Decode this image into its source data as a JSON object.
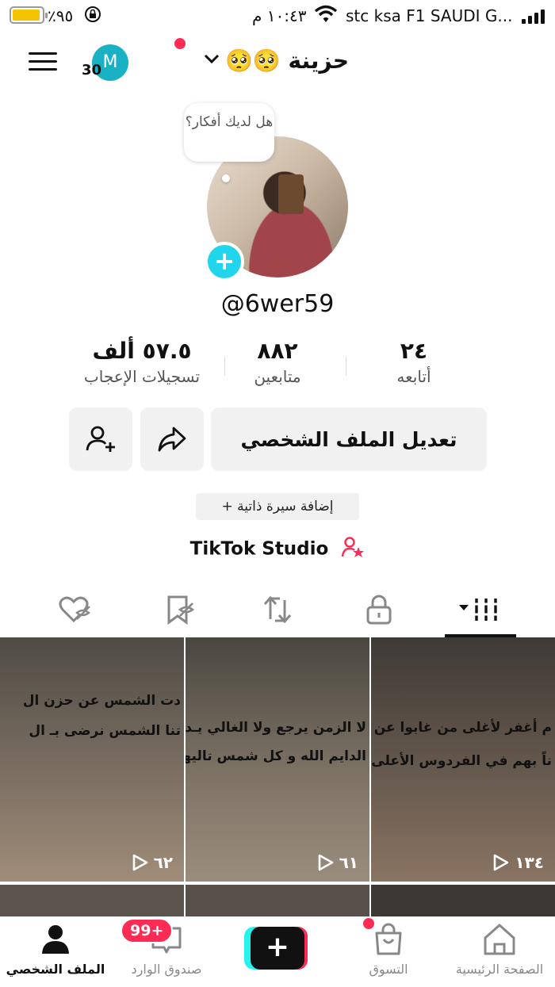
{
  "status_bar": {
    "battery_percent": "٪٩٥",
    "time": "١٠:٤٣ م",
    "carrier": "stc ksa F1 SAUDI G..."
  },
  "header": {
    "account_name": "حزينة 🥺🥺",
    "avatar_letter": "M",
    "badge_count": "30"
  },
  "profile": {
    "thought_bubble": "هل لديك أفكار؟",
    "username": "@6wer59"
  },
  "stats": {
    "following": {
      "value": "٢٤",
      "label": "أتابعه"
    },
    "followers": {
      "value": "٨٨٢",
      "label": "متابعين"
    },
    "likes": {
      "value": "٥٧.٥ ألف",
      "label": "تسجيلات الإعجاب"
    }
  },
  "actions": {
    "edit_profile": "تعديل الملف الشخصي",
    "add_bio": "+ إضافة سيرة ذاتية",
    "studio": "TikTok Studio"
  },
  "tabs": [
    {
      "icon": "grid-icon",
      "active": true
    },
    {
      "icon": "lock-icon",
      "active": false
    },
    {
      "icon": "repost-icon",
      "active": false
    },
    {
      "icon": "bookmark-icon",
      "active": false
    },
    {
      "icon": "liked-icon",
      "active": false
    }
  ],
  "videos": [
    {
      "lines": [
        "دت الشمس عن حزن ال",
        "تنا الشمس نرضى بـ ال"
      ],
      "views": "٦٢"
    },
    {
      "lines": [
        "لا الزمن يرجع ولا الغالي يـد",
        "الدايم الله و كل شمس تاليها غ"
      ],
      "views": "٦١"
    },
    {
      "lines": [
        "م أغفر لأغلى من غابوا عن آلت",
        "ناً بهم في الفردوس الأعلى يآرب"
      ],
      "views": "١٣٤"
    }
  ],
  "bottom_nav": {
    "profile": "الملف الشخصي",
    "inbox": "صندوق الوارد",
    "inbox_badge": "99+",
    "shop": "التسوق",
    "home": "الصفحة الرئيسية"
  },
  "colors": {
    "accent": "#fe2c55",
    "cyan": "#20d5ec",
    "button_bg": "#f1f1f2"
  }
}
